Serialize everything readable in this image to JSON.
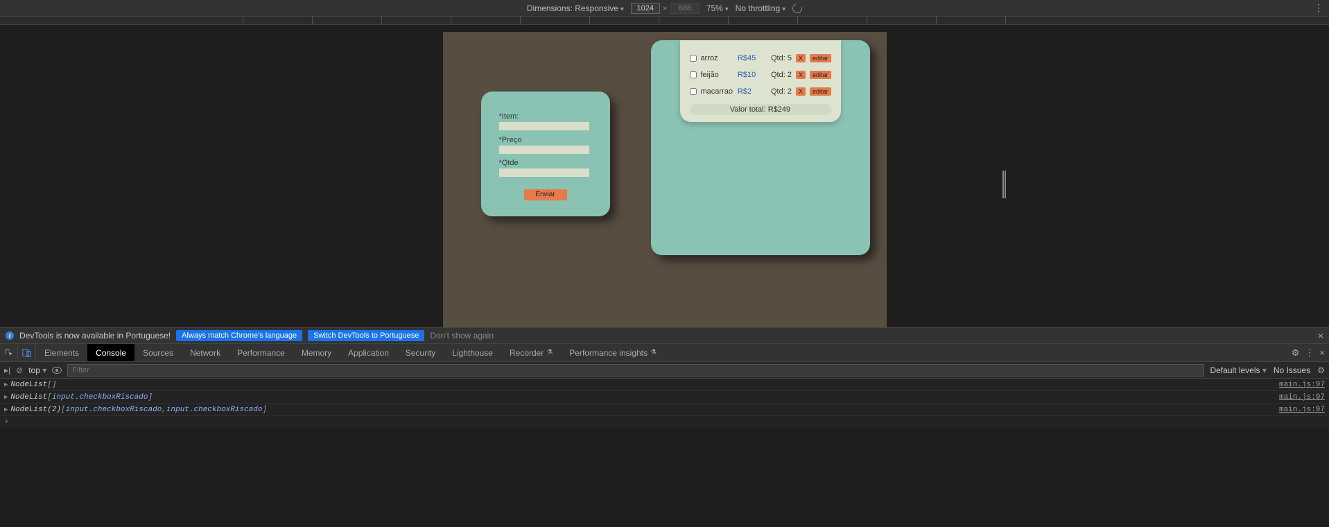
{
  "device_toolbar": {
    "dimensions_label": "Dimensions: Responsive",
    "width_value": "1024",
    "height_value": "688",
    "zoom": "75%",
    "throttling": "No throttling"
  },
  "app": {
    "form": {
      "item_label": "*Item:",
      "price_label": "*Preço",
      "qty_label": "*Qtde",
      "submit_label": "Enviar"
    },
    "list": {
      "rows": [
        {
          "name": "arroz",
          "price": "R$45",
          "qty": "Qtd: 5"
        },
        {
          "name": "feijão",
          "price": "R$10",
          "qty": "Qtd: 2"
        },
        {
          "name": "macarrao",
          "price": "R$2",
          "qty": "Qtd: 2"
        }
      ],
      "delete_label": "X",
      "edit_label": "editar",
      "total_label": "Valor total: R$249"
    }
  },
  "lang_banner": {
    "message": "DevTools is now available in Portuguese!",
    "btn_match": "Always match Chrome's language",
    "btn_switch": "Switch DevTools to Portuguese",
    "dont_show": "Don't show again"
  },
  "devtools_tabs": {
    "elements": "Elements",
    "console": "Console",
    "sources": "Sources",
    "network": "Network",
    "performance": "Performance",
    "memory": "Memory",
    "application": "Application",
    "security": "Security",
    "lighthouse": "Lighthouse",
    "recorder": "Recorder",
    "performance_insights": "Performance insights"
  },
  "console_toolbar": {
    "context": "top",
    "filter_placeholder": "Filter",
    "levels": "Default levels",
    "issues": "No Issues"
  },
  "console_lines": {
    "l0": {
      "type": "NodeList",
      "open": " [",
      "content": "",
      "close": "]",
      "src": "main.js:97"
    },
    "l1": {
      "type": "NodeList",
      "open": " [",
      "cls1": "input.checkboxRiscado",
      "close": "]",
      "src": "main.js:97"
    },
    "l2": {
      "type": "NodeList(2)",
      "open": " [",
      "cls1": "input.checkboxRiscado",
      "sep": ", ",
      "cls2": "input.checkboxRiscado",
      "close": "]",
      "src": "main.js:97"
    }
  }
}
